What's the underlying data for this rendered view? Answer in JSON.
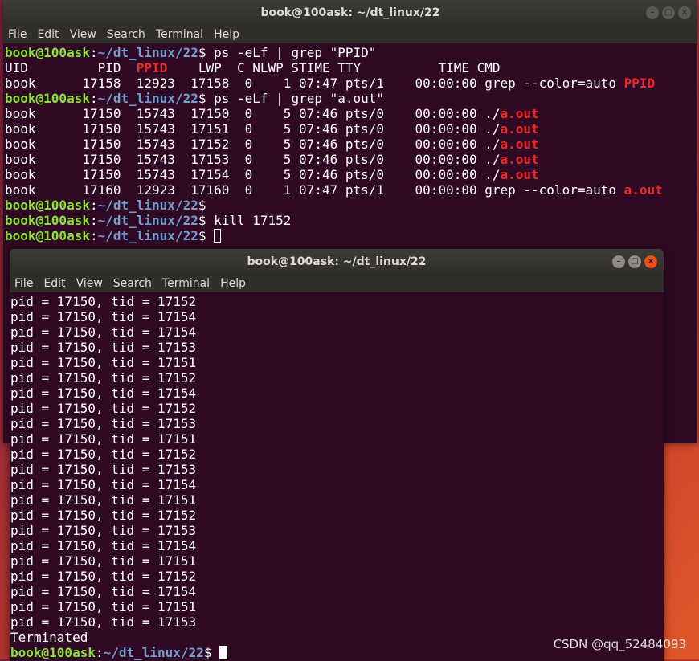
{
  "back_window": {
    "title": "book@100ask: ~/dt_linux/22",
    "menu": [
      "File",
      "Edit",
      "View",
      "Search",
      "Terminal",
      "Help"
    ],
    "lines": [
      [
        {
          "t": "book@100ask",
          "c": "user"
        },
        {
          "t": ":",
          "c": ""
        },
        {
          "t": "~/dt_linux/22",
          "c": "path"
        },
        {
          "t": "$ ps -eLf | grep \"PPID\"",
          "c": ""
        }
      ],
      [
        {
          "t": "UID         PID  ",
          "c": ""
        },
        {
          "t": "PPID",
          "c": "hl"
        },
        {
          "t": "    LWP  C NLWP STIME TTY          TIME CMD",
          "c": ""
        }
      ],
      [
        {
          "t": "book      17158  12923  17158  0    1 07:47 pts/1    00:00:00 grep --color=auto ",
          "c": ""
        },
        {
          "t": "PPID",
          "c": "hl"
        }
      ],
      [
        {
          "t": "book@100ask",
          "c": "user"
        },
        {
          "t": ":",
          "c": ""
        },
        {
          "t": "~/dt_linux/22",
          "c": "path"
        },
        {
          "t": "$ ps -eLf | grep \"a.out\"",
          "c": ""
        }
      ],
      [
        {
          "t": "book      17150  15743  17150  0    5 07:46 pts/0    00:00:00 ./",
          "c": ""
        },
        {
          "t": "a.out",
          "c": "hl"
        }
      ],
      [
        {
          "t": "book      17150  15743  17151  0    5 07:46 pts/0    00:00:00 ./",
          "c": ""
        },
        {
          "t": "a.out",
          "c": "hl"
        }
      ],
      [
        {
          "t": "book      17150  15743  17152  0    5 07:46 pts/0    00:00:00 ./",
          "c": ""
        },
        {
          "t": "a.out",
          "c": "hl"
        }
      ],
      [
        {
          "t": "book      17150  15743  17153  0    5 07:46 pts/0    00:00:00 ./",
          "c": ""
        },
        {
          "t": "a.out",
          "c": "hl"
        }
      ],
      [
        {
          "t": "book      17150  15743  17154  0    5 07:46 pts/0    00:00:00 ./",
          "c": ""
        },
        {
          "t": "a.out",
          "c": "hl"
        }
      ],
      [
        {
          "t": "book      17160  12923  17160  0    1 07:47 pts/1    00:00:00 grep --color=auto ",
          "c": ""
        },
        {
          "t": "a.out",
          "c": "hl"
        }
      ],
      [
        {
          "t": "book@100ask",
          "c": "user"
        },
        {
          "t": ":",
          "c": ""
        },
        {
          "t": "~/dt_linux/22",
          "c": "path"
        },
        {
          "t": "$",
          "c": ""
        }
      ],
      [
        {
          "t": "book@100ask",
          "c": "user"
        },
        {
          "t": ":",
          "c": ""
        },
        {
          "t": "~/dt_linux/22",
          "c": "path"
        },
        {
          "t": "$ kill 17152",
          "c": ""
        }
      ],
      [
        {
          "t": "book@100ask",
          "c": "user"
        },
        {
          "t": ":",
          "c": ""
        },
        {
          "t": "~/dt_linux/22",
          "c": "path"
        },
        {
          "t": "$ ",
          "c": ""
        },
        {
          "t": "",
          "c": "cursor-hollow"
        }
      ]
    ]
  },
  "front_window": {
    "title": "book@100ask: ~/dt_linux/22",
    "menu": [
      "File",
      "Edit",
      "View",
      "Search",
      "Terminal",
      "Help"
    ],
    "lines": [
      [
        {
          "t": "pid = 17150, tid = 17152",
          "c": ""
        }
      ],
      [
        {
          "t": "pid = 17150, tid = 17154",
          "c": ""
        }
      ],
      [
        {
          "t": "pid = 17150, tid = 17154",
          "c": ""
        }
      ],
      [
        {
          "t": "pid = 17150, tid = 17153",
          "c": ""
        }
      ],
      [
        {
          "t": "pid = 17150, tid = 17151",
          "c": ""
        }
      ],
      [
        {
          "t": "pid = 17150, tid = 17152",
          "c": ""
        }
      ],
      [
        {
          "t": "pid = 17150, tid = 17154",
          "c": ""
        }
      ],
      [
        {
          "t": "pid = 17150, tid = 17152",
          "c": ""
        }
      ],
      [
        {
          "t": "pid = 17150, tid = 17153",
          "c": ""
        }
      ],
      [
        {
          "t": "pid = 17150, tid = 17151",
          "c": ""
        }
      ],
      [
        {
          "t": "pid = 17150, tid = 17152",
          "c": ""
        }
      ],
      [
        {
          "t": "pid = 17150, tid = 17153",
          "c": ""
        }
      ],
      [
        {
          "t": "pid = 17150, tid = 17154",
          "c": ""
        }
      ],
      [
        {
          "t": "pid = 17150, tid = 17151",
          "c": ""
        }
      ],
      [
        {
          "t": "pid = 17150, tid = 17152",
          "c": ""
        }
      ],
      [
        {
          "t": "pid = 17150, tid = 17153",
          "c": ""
        }
      ],
      [
        {
          "t": "pid = 17150, tid = 17154",
          "c": ""
        }
      ],
      [
        {
          "t": "pid = 17150, tid = 17151",
          "c": ""
        }
      ],
      [
        {
          "t": "pid = 17150, tid = 17152",
          "c": ""
        }
      ],
      [
        {
          "t": "pid = 17150, tid = 17154",
          "c": ""
        }
      ],
      [
        {
          "t": "pid = 17150, tid = 17151",
          "c": ""
        }
      ],
      [
        {
          "t": "pid = 17150, tid = 17153",
          "c": ""
        }
      ],
      [
        {
          "t": "Terminated",
          "c": ""
        }
      ],
      [
        {
          "t": "book@100ask",
          "c": "user"
        },
        {
          "t": ":",
          "c": ""
        },
        {
          "t": "~/dt_linux/22",
          "c": "path"
        },
        {
          "t": "$ ",
          "c": ""
        },
        {
          "t": "",
          "c": "cursor-solid"
        }
      ]
    ]
  },
  "watermark": "CSDN @qq_52484093",
  "colors": {
    "terminal_bg": "#300a24",
    "prompt_user": "#8ae234",
    "prompt_path": "#729fcf",
    "highlight": "#ef2929"
  }
}
